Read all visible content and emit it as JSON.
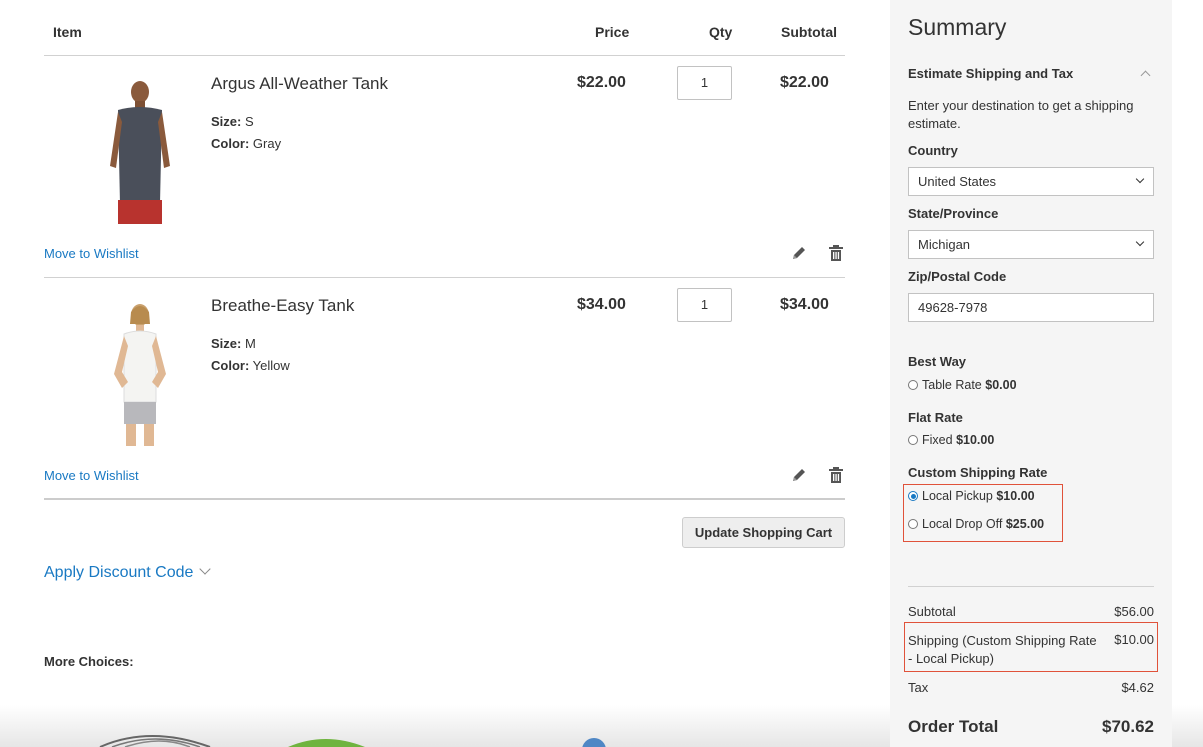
{
  "cart": {
    "headers": {
      "item": "Item",
      "price": "Price",
      "qty": "Qty",
      "subtotal": "Subtotal"
    },
    "items": [
      {
        "name": "Argus All-Weather Tank",
        "size_label": "Size:",
        "size": "S",
        "color_label": "Color:",
        "color": "Gray",
        "price": "$22.00",
        "qty": "1",
        "subtotal": "$22.00",
        "wishlist": "Move to Wishlist",
        "image_icon": "man-in-gray-tank-photo"
      },
      {
        "name": "Breathe-Easy Tank",
        "size_label": "Size:",
        "size": "M",
        "color_label": "Color:",
        "color": "Yellow",
        "price": "$34.00",
        "qty": "1",
        "subtotal": "$34.00",
        "wishlist": "Move to Wishlist",
        "image_icon": "woman-in-white-tank-photo"
      }
    ],
    "update_button": "Update Shopping Cart",
    "discount_label": "Apply Discount Code",
    "more_choices": "More Choices:"
  },
  "summary": {
    "title": "Summary",
    "estimate_heading": "Estimate Shipping and Tax",
    "estimate_description": "Enter your destination to get a shipping estimate.",
    "country_label": "Country",
    "country_value": "United States",
    "state_label": "State/Province",
    "state_value": "Michigan",
    "zip_label": "Zip/Postal Code",
    "zip_value": "49628-7978",
    "methods": [
      {
        "title": "Best Way",
        "options": [
          {
            "label": "Table Rate",
            "price": "$0.00",
            "selected": false
          }
        ]
      },
      {
        "title": "Flat Rate",
        "options": [
          {
            "label": "Fixed",
            "price": "$10.00",
            "selected": false
          }
        ]
      },
      {
        "title": "Custom Shipping Rate",
        "options": [
          {
            "label": "Local Pickup",
            "price": "$10.00",
            "selected": true
          },
          {
            "label": "Local Drop Off",
            "price": "$25.00",
            "selected": false
          }
        ]
      }
    ],
    "totals": {
      "subtotal_label": "Subtotal",
      "subtotal_value": "$56.00",
      "shipping_label": "Shipping (Custom Shipping Rate - Local Pickup)",
      "shipping_value": "$10.00",
      "tax_label": "Tax",
      "tax_value": "$4.62",
      "order_total_label": "Order Total",
      "order_total_value": "$70.62"
    }
  },
  "colors": {
    "link": "#1979c3",
    "highlight_border": "#e0523a",
    "sidebar_bg": "#f5f5f5"
  }
}
